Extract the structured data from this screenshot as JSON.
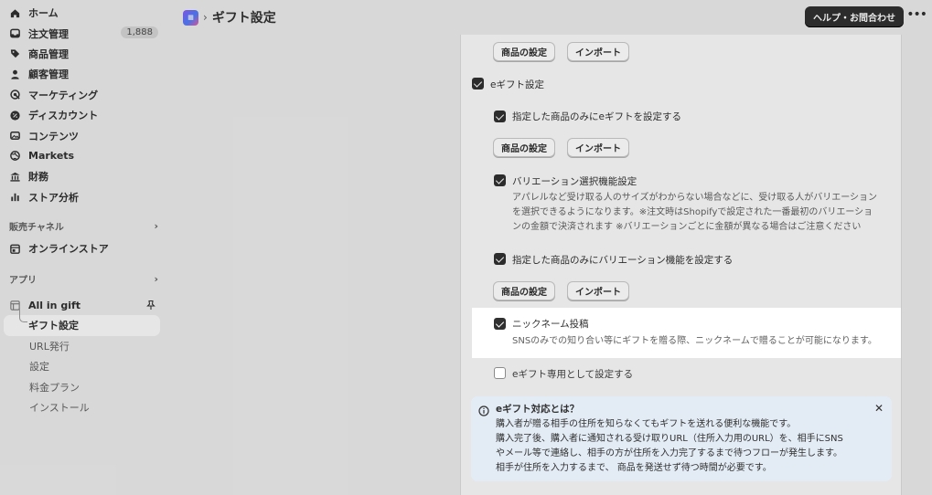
{
  "sidebar": {
    "items": [
      {
        "label": "ホーム"
      },
      {
        "label": "注文管理",
        "badge": "1,888"
      },
      {
        "label": "商品管理"
      },
      {
        "label": "顧客管理"
      },
      {
        "label": "マーケティング"
      },
      {
        "label": "ディスカウント"
      },
      {
        "label": "コンテンツ"
      },
      {
        "label": "Markets"
      },
      {
        "label": "財務"
      },
      {
        "label": "ストア分析"
      }
    ],
    "sales_channels_label": "販売チャネル",
    "online_store_label": "オンラインストア",
    "apps_label": "アプリ",
    "app_name": "All in gift",
    "app_subitems": [
      "ギフト設定",
      "URL発行",
      "設定",
      "料金プラン",
      "インストール"
    ]
  },
  "header": {
    "title": "ギフト設定",
    "help_label": "ヘルプ・お問合わせ",
    "more_label": "•••"
  },
  "main": {
    "product_settings_label": "商品の設定",
    "import_label": "インポート",
    "egift_setting_label": "eギフト設定",
    "specified_products_egift_label": "指定した商品のみにeギフトを設定する",
    "variation_label": "バリエーション選択機能設定",
    "variation_desc_lines": [
      "アパレルなど受け取る人のサイズがわからない場合などに、受け取る人がバリエーション",
      "を選択できるようになります。※注文時はShopifyで設定された一番最初のバリエーショ",
      "ンの金額で決済されます ※バリエーションごとに金額が異なる場合はご注意ください"
    ],
    "specified_products_variation_label": "指定した商品のみにバリエーション機能を設定する",
    "nickname_label": "ニックネーム投稿",
    "nickname_desc": "SNSのみでの知り合い等にギフトを贈る際、ニックネームで贈ることが可能になります。",
    "egift_only_label": "eギフト専用として設定する"
  },
  "banner": {
    "title": "eギフト対応とは？",
    "lines": [
      "購入者が贈る相手の住所を知らなくてもギフトを送れる便利な機能です。",
      "購入完了後、購入者に通知される受け取りURL（住所入力用のURL）を、相手にSNS",
      "やメール等で連絡し、相手の方が住所を入力完了するまで待つフローが発生します。",
      "相手が住所を入力するまで、 商品を発送せず待つ時間が必要です。"
    ],
    "close_label": "✕"
  }
}
